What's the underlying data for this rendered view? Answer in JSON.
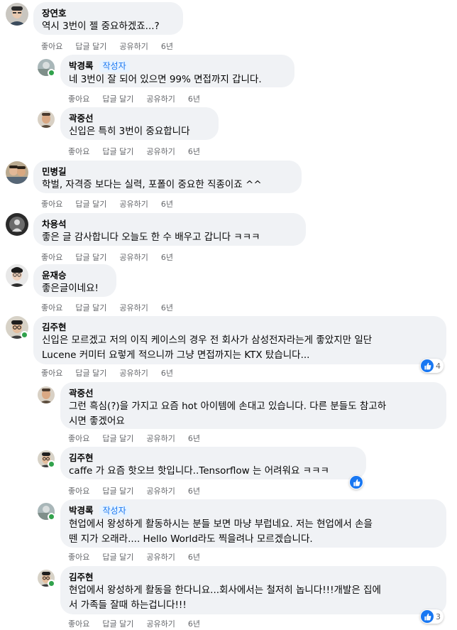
{
  "comments": [
    {
      "name": "장연호",
      "text": "역시 3번이 젤 중요하겠죠...?",
      "like": "좋아요",
      "reply": "답글 달기",
      "share": "공유하기",
      "age": "6년"
    },
    {
      "name": "박경록",
      "badge": "작성자",
      "text": "네 3번이 잘 되어 있으면 99% 면접까지 갑니다.",
      "like": "좋아요",
      "reply": "답글 달기",
      "share": "공유하기",
      "age": "6년"
    },
    {
      "name": "곽중선",
      "text": "신입은 특히 3번이 중요합니다",
      "like": "좋아요",
      "reply": "답글 달기",
      "share": "공유하기",
      "age": "6년"
    },
    {
      "name": "민병길",
      "text": "학벌, 자격증 보다는 실력, 포폴이 중요한 직종이죠 ^^",
      "like": "좋아요",
      "reply": "답글 달기",
      "share": "공유하기",
      "age": "6년"
    },
    {
      "name": "차용석",
      "text": "좋은 글 감사합니다 오늘도 한 수 배우고 갑니다 ㅋㅋㅋ",
      "like": "좋아요",
      "reply": "답글 달기",
      "share": "공유하기",
      "age": "6년"
    },
    {
      "name": "윤재승",
      "text": "좋은글이네요!",
      "like": "좋아요",
      "reply": "답글 달기",
      "share": "공유하기",
      "age": "6년"
    },
    {
      "name": "김주현",
      "text1": "신입은 모르겠고 저의 이직 케이스의 경우 전 회사가 삼성전자라는게 좋았지만 일단",
      "text2": "Lucene 커미터 요렇게 적으니까 그냥 면접까지는 KTX 탔습니다...",
      "like": "좋아요",
      "reply": "답글 달기",
      "share": "공유하기",
      "age": "6년",
      "reactions": "4"
    },
    {
      "name": "곽중선",
      "text1": "그런 흑심(?)을 가지고 요즘 hot 아이템에 손대고 있습니다. 다른 분들도 참고하",
      "text2": "시면 좋겠어요",
      "like": "좋아요",
      "reply": "답글 달기",
      "share": "공유하기",
      "age": "6년"
    },
    {
      "name": "김주현",
      "text": "caffe 가 요즘 핫오브 핫입니다..Tensorflow 는 어려워요 ㅋㅋㅋ",
      "like": "좋아요",
      "reply": "답글 달기",
      "share": "공유하기",
      "age": "6년"
    },
    {
      "name": "박경록",
      "badge": "작성자",
      "text1": "현업에서 왕성하게 활동하시는 분들 보면 마냥 부럽네요. 저는 현업에서 손을",
      "text2": "뗀 지가 오래라.... Hello World라도 찍을려나 모르겠습니다.",
      "like": "좋아요",
      "reply": "답글 달기",
      "share": "공유하기",
      "age": "6년"
    },
    {
      "name": "김주현",
      "text1": "현업에서 왕성하게 활동을 한다니요...회사에서는 철저히 놉니다!!!개발은 집에",
      "text2": "서 가족들 잘때 하는겁니다!!!",
      "like": "좋아요",
      "reply": "답글 달기",
      "share": "공유하기",
      "age": "6년",
      "reactions": "3"
    }
  ],
  "colors": {
    "bubble": "#f0f2f5",
    "text": "#050505",
    "meta": "#65676b",
    "like_blue": "#1877f2",
    "online": "#31a24c",
    "badge_bg": "#e7f3ff"
  },
  "icons": {
    "like": "thumbs-up-icon"
  }
}
